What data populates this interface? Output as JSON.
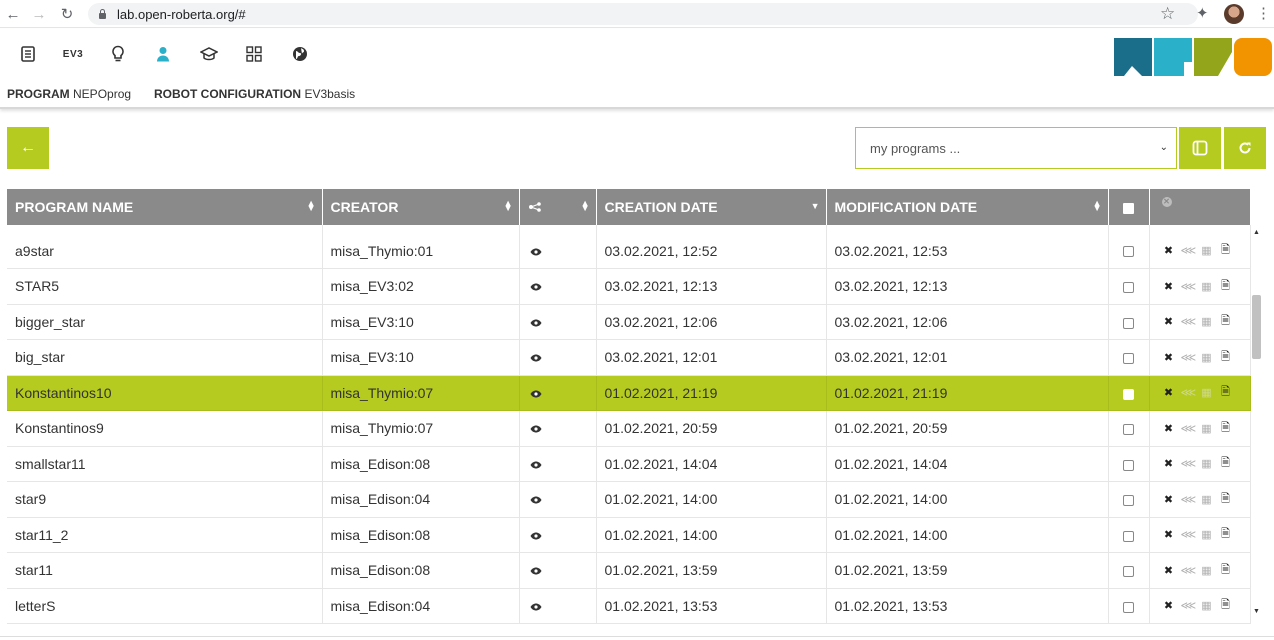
{
  "browser": {
    "url": "lab.open-roberta.org/#"
  },
  "header": {
    "ev3_label": "EV3",
    "program_label": "PROGRAM",
    "program_name": "NEPOprog",
    "robot_label": "ROBOT CONFIGURATION",
    "robot_name": "EV3basis",
    "logo_colors": [
      "#1a6e8a",
      "#2ab0c9",
      "#93a51b",
      "#f29400"
    ]
  },
  "toolbar": {
    "select_value": "my programs ...",
    "back_icon": "arrow-left",
    "copy_icon": "copy",
    "refresh_icon": "refresh"
  },
  "table": {
    "columns": [
      "PROGRAM NAME",
      "CREATOR",
      "",
      "CREATION DATE",
      "MODIFICATION DATE",
      "",
      ""
    ],
    "rows": [
      {
        "name": "a9star",
        "creator": "misa_Thymio:01",
        "created": "03.02.2021, 12:52",
        "modified": "03.02.2021, 12:53"
      },
      {
        "name": "STAR5",
        "creator": "misa_EV3:02",
        "created": "03.02.2021, 12:13",
        "modified": "03.02.2021, 12:13"
      },
      {
        "name": "bigger_star",
        "creator": "misa_EV3:10",
        "created": "03.02.2021, 12:06",
        "modified": "03.02.2021, 12:06"
      },
      {
        "name": "big_star",
        "creator": "misa_EV3:10",
        "created": "03.02.2021, 12:01",
        "modified": "03.02.2021, 12:01"
      },
      {
        "name": "Konstantinos10",
        "creator": "misa_Thymio:07",
        "created": "01.02.2021, 21:19",
        "modified": "01.02.2021, 21:19",
        "selected": true
      },
      {
        "name": "Konstantinos9",
        "creator": "misa_Thymio:07",
        "created": "01.02.2021, 20:59",
        "modified": "01.02.2021, 20:59"
      },
      {
        "name": "smallstar11",
        "creator": "misa_Edison:08",
        "created": "01.02.2021, 14:04",
        "modified": "01.02.2021, 14:04"
      },
      {
        "name": "star9",
        "creator": "misa_Edison:04",
        "created": "01.02.2021, 14:00",
        "modified": "01.02.2021, 14:00"
      },
      {
        "name": "star11_2",
        "creator": "misa_Edison:08",
        "created": "01.02.2021, 14:00",
        "modified": "01.02.2021, 14:00"
      },
      {
        "name": "star11",
        "creator": "misa_Edison:08",
        "created": "01.02.2021, 13:59",
        "modified": "01.02.2021, 13:59"
      },
      {
        "name": "letterS",
        "creator": "misa_Edison:04",
        "created": "01.02.2021, 13:53",
        "modified": "01.02.2021, 13:53"
      }
    ]
  },
  "colors": {
    "accent": "#b5cb1f",
    "header_gray": "#8a8a8a"
  }
}
